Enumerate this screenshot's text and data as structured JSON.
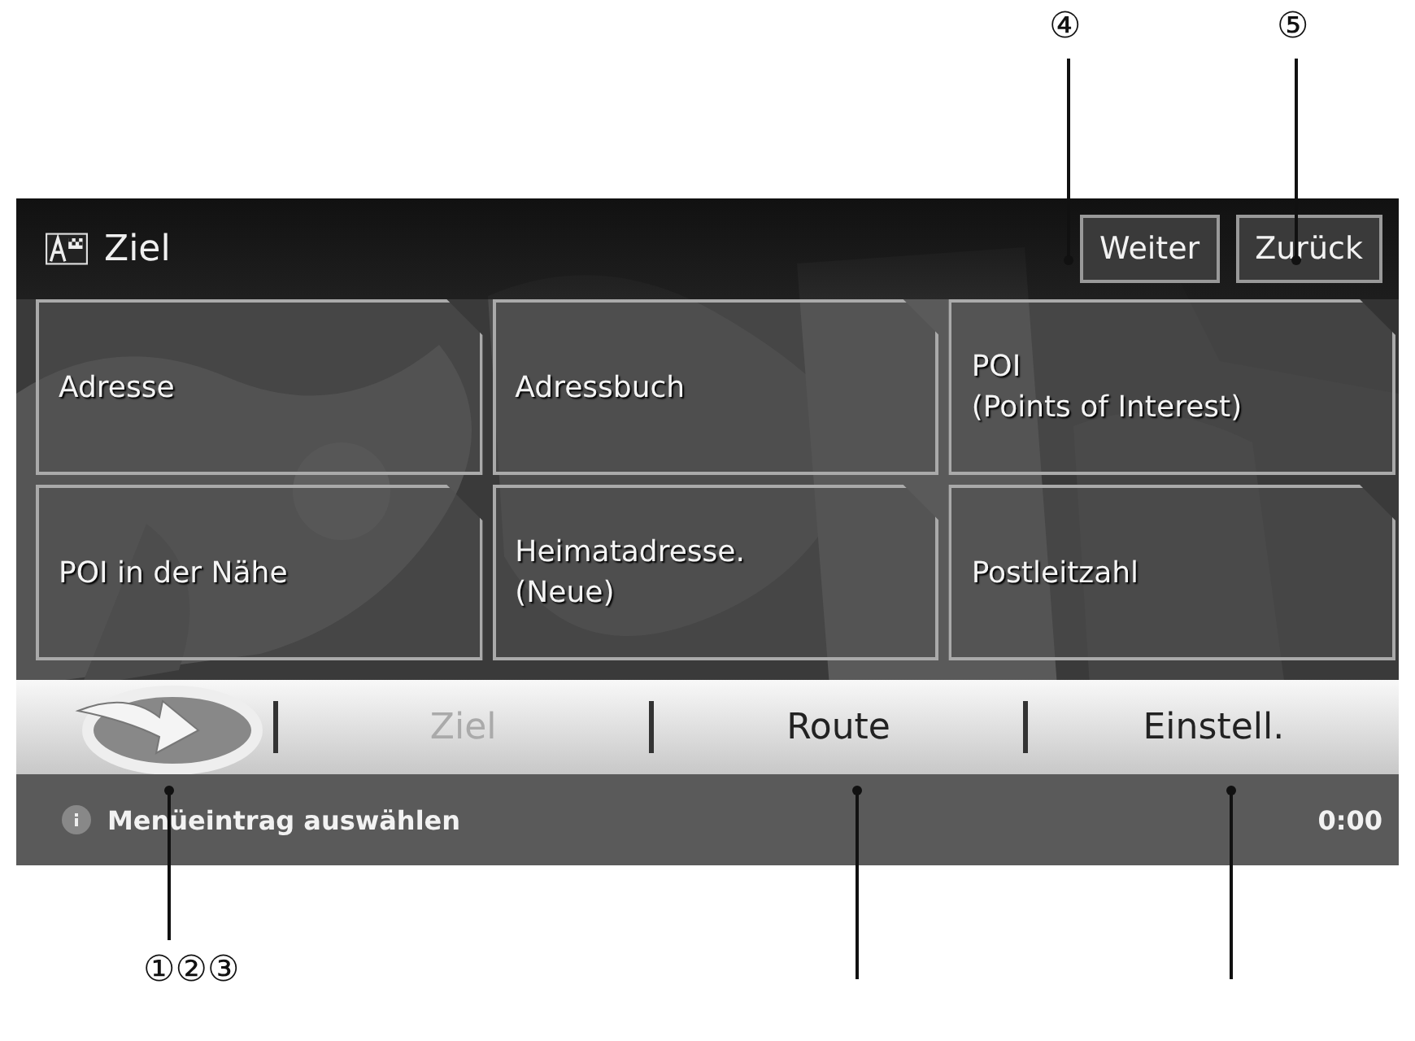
{
  "callouts_top": [
    "④",
    "⑤"
  ],
  "header": {
    "title": "Ziel"
  },
  "header_buttons": [
    {
      "label": "Weiter"
    },
    {
      "label": "Zurück"
    }
  ],
  "tiles": [
    {
      "lines": [
        "Adresse"
      ]
    },
    {
      "lines": [
        "Adressbuch"
      ]
    },
    {
      "lines": [
        "POI",
        "(Points of Interest)"
      ]
    },
    {
      "lines": [
        "POI in der Nähe"
      ]
    },
    {
      "lines": [
        "Heimatadresse.",
        "(Neue)"
      ]
    },
    {
      "lines": [
        "Postleitzahl"
      ]
    }
  ],
  "menu": [
    {
      "label": "Ziel",
      "disabled": true
    },
    {
      "label": "Route",
      "disabled": false
    },
    {
      "label": "Einstell.",
      "disabled": false
    }
  ],
  "status": {
    "message": "Menüeintrag auswählen",
    "time": "0:00"
  },
  "callouts_bottom": [
    "①②③"
  ]
}
